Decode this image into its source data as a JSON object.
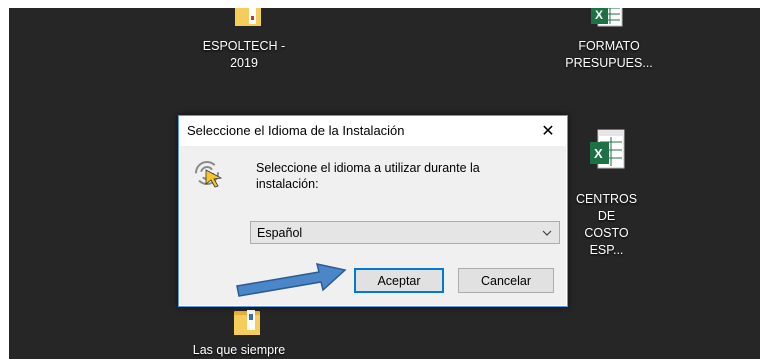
{
  "desktop": {
    "icons": [
      {
        "label_1": "ESPOLTECH -",
        "label_2": "2019",
        "icon": "folder-icon"
      },
      {
        "label_1": "FORMATO",
        "label_2": "PRESUPUES...",
        "icon": "excel-file-icon"
      },
      {
        "label_1": "CENTROS DE",
        "label_2": "COSTO ESP...",
        "icon": "excel-file-icon"
      },
      {
        "label_1": "Las que siempre",
        "icon": "folder-icon"
      }
    ]
  },
  "dialog": {
    "title": "Seleccione el Idioma de la Instalación",
    "close_glyph": "✕",
    "prompt": "Seleccione el idioma a utilizar durante la instalación:",
    "selected_language": "Español",
    "ok_label": "Aceptar",
    "cancel_label": "Cancelar"
  },
  "colors": {
    "desktop_bg": "#262626",
    "focus_border": "#0078d7",
    "annotation_arrow": "#4a86c8"
  }
}
